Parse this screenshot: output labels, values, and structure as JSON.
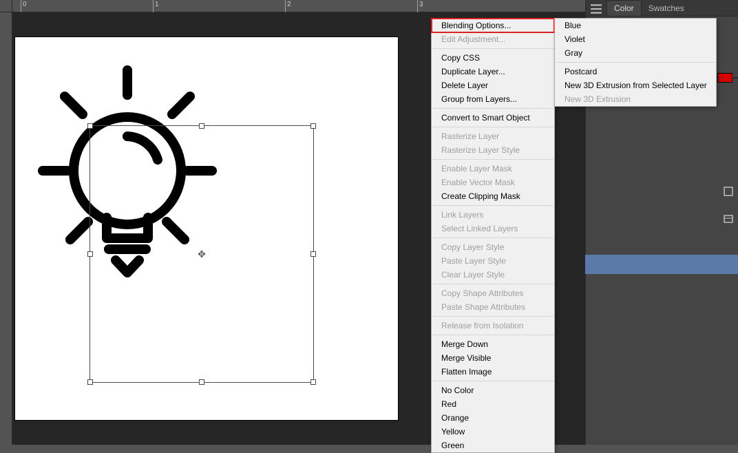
{
  "ruler": {
    "marks": [
      "0",
      "1",
      "2",
      "3"
    ]
  },
  "rightPanel": {
    "tabs": {
      "active": "Color",
      "other": "Swatches"
    }
  },
  "contextMenu": [
    {
      "label": "Blending Options...",
      "enabled": true,
      "highlight": true
    },
    {
      "label": "Edit Adjustment...",
      "enabled": false
    },
    null,
    {
      "label": "Copy CSS",
      "enabled": true
    },
    {
      "label": "Duplicate Layer...",
      "enabled": true
    },
    {
      "label": "Delete Layer",
      "enabled": true
    },
    {
      "label": "Group from Layers...",
      "enabled": true
    },
    null,
    {
      "label": "Convert to Smart Object",
      "enabled": true
    },
    null,
    {
      "label": "Rasterize Layer",
      "enabled": false
    },
    {
      "label": "Rasterize Layer Style",
      "enabled": false
    },
    null,
    {
      "label": "Enable Layer Mask",
      "enabled": false
    },
    {
      "label": "Enable Vector Mask",
      "enabled": false
    },
    {
      "label": "Create Clipping Mask",
      "enabled": true
    },
    null,
    {
      "label": "Link Layers",
      "enabled": false
    },
    {
      "label": "Select Linked Layers",
      "enabled": false
    },
    null,
    {
      "label": "Copy Layer Style",
      "enabled": false
    },
    {
      "label": "Paste Layer Style",
      "enabled": false
    },
    {
      "label": "Clear Layer Style",
      "enabled": false
    },
    null,
    {
      "label": "Copy Shape Attributes",
      "enabled": false
    },
    {
      "label": "Paste Shape Attributes",
      "enabled": false
    },
    null,
    {
      "label": "Release from Isolation",
      "enabled": false
    },
    null,
    {
      "label": "Merge Down",
      "enabled": true
    },
    {
      "label": "Merge Visible",
      "enabled": true
    },
    {
      "label": "Flatten Image",
      "enabled": true
    },
    null,
    {
      "label": "No Color",
      "enabled": true
    },
    {
      "label": "Red",
      "enabled": true
    },
    {
      "label": "Orange",
      "enabled": true
    },
    {
      "label": "Yellow",
      "enabled": true
    },
    {
      "label": "Green",
      "enabled": true
    }
  ],
  "submenu": [
    {
      "label": "Blue",
      "enabled": true
    },
    {
      "label": "Violet",
      "enabled": true
    },
    {
      "label": "Gray",
      "enabled": true
    },
    null,
    {
      "label": "Postcard",
      "enabled": true
    },
    {
      "label": "New 3D Extrusion from Selected Layer",
      "enabled": true
    },
    {
      "label": "New 3D Extrusion",
      "enabled": false
    }
  ]
}
